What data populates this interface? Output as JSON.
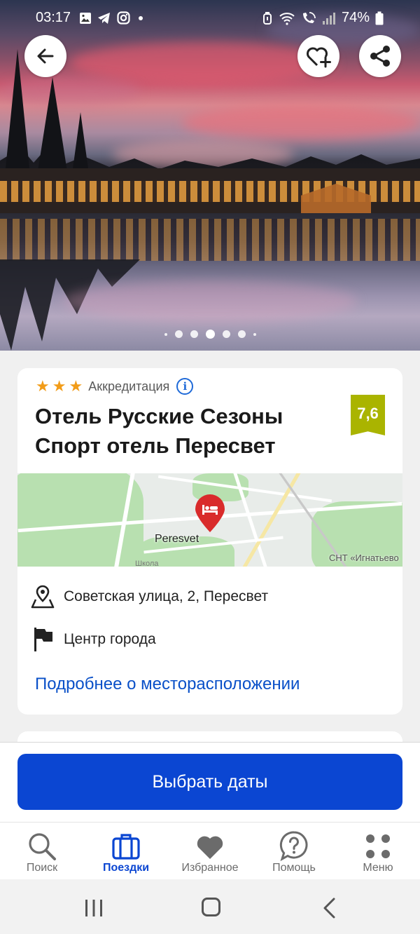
{
  "status_bar": {
    "time": "03:17",
    "battery": "74%",
    "left_icons": [
      "gallery-icon",
      "telegram-icon",
      "instagram-icon",
      "dot-icon"
    ],
    "right_icons": [
      "alarm-icon",
      "wifi-icon",
      "wifi-call-icon",
      "signal-icon",
      "battery-icon"
    ]
  },
  "hero": {
    "photo_count": 7,
    "active_photo": 4
  },
  "hotel": {
    "stars": 3,
    "accreditation_label": "Аккредитация",
    "name": "Отель Русские Сезоны Спорт отель Пересвет",
    "score": "7,6",
    "score_color": "#aab400"
  },
  "map": {
    "city_label": "Peresvet",
    "area_label": "СНТ «Игнатьево",
    "poi_label": "Школа",
    "pin_color": "#d92b2b"
  },
  "location": {
    "address": "Советская улица, 2, Пересвет",
    "district": "Центр города",
    "more_link": "Подробнее о месторасположении"
  },
  "cta": {
    "label": "Выбрать даты",
    "color": "#0b46d2"
  },
  "tabs": [
    {
      "label": "Поиск",
      "icon": "search-icon",
      "active": false
    },
    {
      "label": "Поездки",
      "icon": "suitcase-icon",
      "active": true
    },
    {
      "label": "Избранное",
      "icon": "heart-icon",
      "active": false
    },
    {
      "label": "Помощь",
      "icon": "help-icon",
      "active": false
    },
    {
      "label": "Меню",
      "icon": "menu-dots-icon",
      "active": false
    }
  ]
}
